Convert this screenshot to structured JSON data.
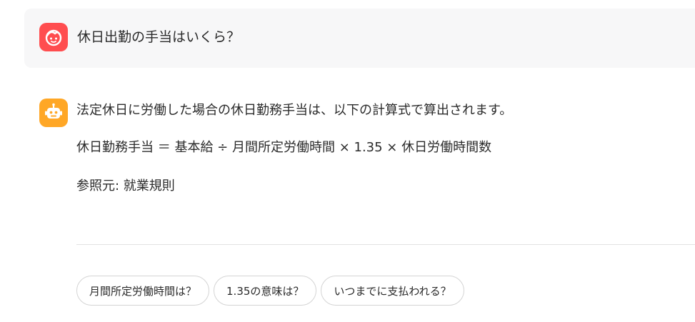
{
  "user_message": {
    "text": "休日出勤の手当はいくら？",
    "avatar_icon": "face-icon",
    "avatar_color": "#ff4d4f"
  },
  "assistant_message": {
    "avatar_icon": "robot-icon",
    "avatar_color": "#ffa726",
    "lines": [
      "法定休日に労働した場合の休日勤務手当は、以下の計算式で算出されます。",
      "休日勤務手当 ＝ 基本給 ÷ 月間所定労働時間 × 1.35 × 休日労働時間数",
      "参照元: 就業規則"
    ]
  },
  "suggestions": [
    "月間所定労働時間は？",
    "1.35の意味は？",
    "いつまでに支払われる？"
  ]
}
